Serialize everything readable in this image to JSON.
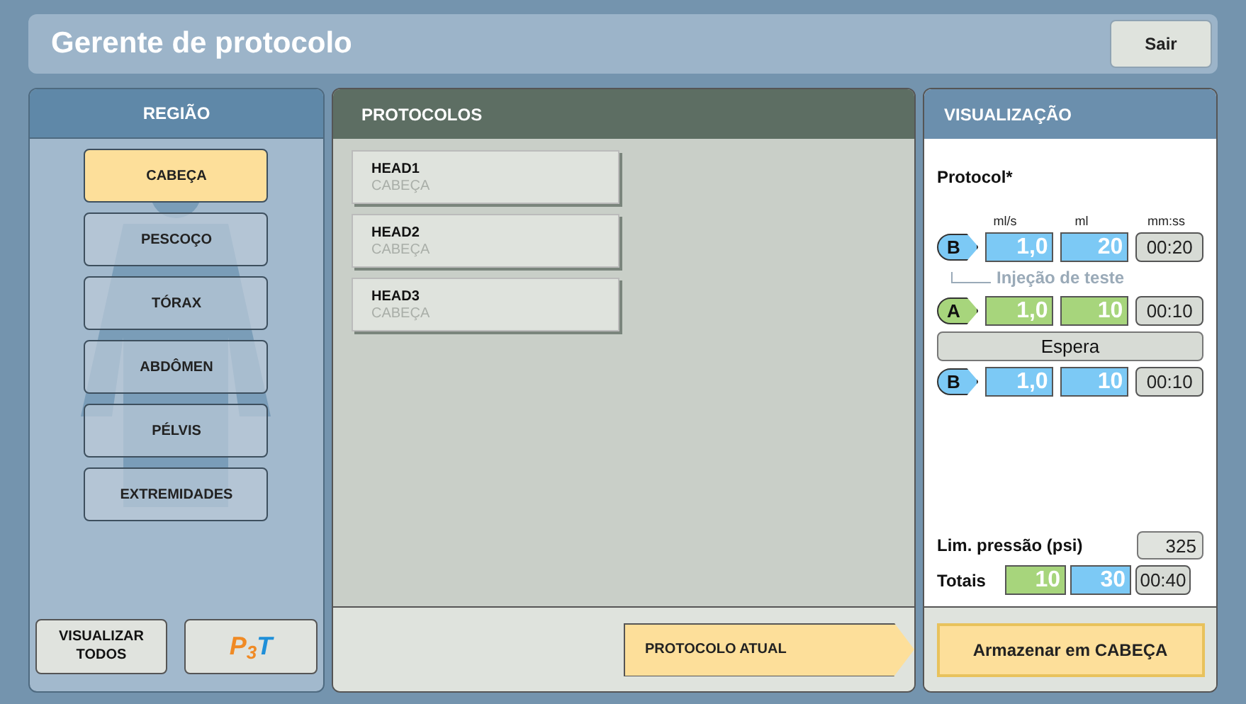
{
  "window": {
    "title": "Gerente de protocolo",
    "exit_button": "Sair"
  },
  "region_panel": {
    "title": "REGIÃO",
    "regions": [
      {
        "label": "CABEÇA",
        "selected": true
      },
      {
        "label": "PESCOÇO",
        "selected": false
      },
      {
        "label": "TÓRAX",
        "selected": false
      },
      {
        "label": "ABDÔMEN",
        "selected": false
      },
      {
        "label": "PÉLVIS",
        "selected": false
      },
      {
        "label": "EXTREMIDADES",
        "selected": false
      }
    ],
    "view_all_button": "VISUALIZAR TODOS",
    "p3t_logo": {
      "p": "P",
      "sub": "3",
      "t": "T"
    }
  },
  "protocols_panel": {
    "title": "PROTOCOLOS",
    "protocols": [
      {
        "name": "HEAD1",
        "region": "CABEÇA"
      },
      {
        "name": "HEAD2",
        "region": "CABEÇA"
      },
      {
        "name": "HEAD3",
        "region": "CABEÇA"
      }
    ],
    "current_protocol_tag": "PROTOCOLO ATUAL"
  },
  "view_panel": {
    "title": "VISUALIZAÇÃO",
    "protocol_name": "Protocol*",
    "columns": [
      "ml/s",
      "ml",
      "mm:ss"
    ],
    "steps": [
      {
        "kind": "phase",
        "syringe": "B",
        "rate": "1,0",
        "volume": "20",
        "time": "00:20"
      },
      {
        "kind": "note",
        "text": "Injeção de teste"
      },
      {
        "kind": "phase",
        "syringe": "A",
        "rate": "1,0",
        "volume": "10",
        "time": "00:10"
      },
      {
        "kind": "pause",
        "text": "Espera"
      },
      {
        "kind": "phase",
        "syringe": "B",
        "rate": "1,0",
        "volume": "10",
        "time": "00:10"
      }
    ],
    "pressure_limit_label": "Lim. pressão (psi)",
    "pressure_limit": "325",
    "totals_label": "Totais",
    "total_a": "10",
    "total_b": "30",
    "total_time": "00:40",
    "store_button": "Armazenar em CABEÇA"
  }
}
